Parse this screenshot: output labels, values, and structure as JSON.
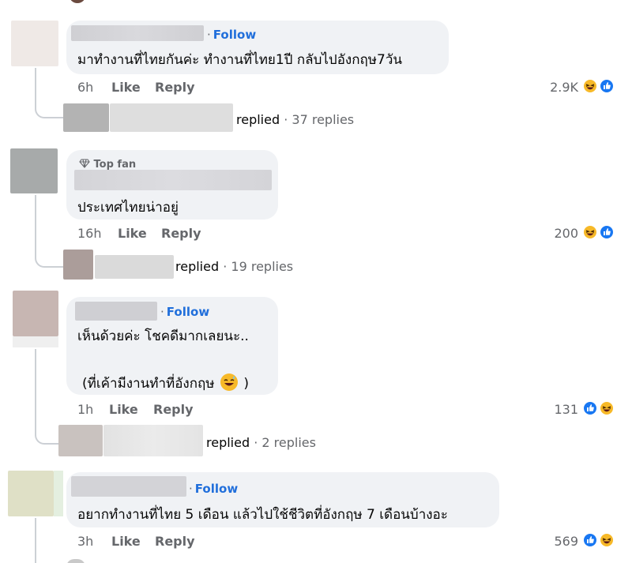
{
  "comments": [
    {
      "follow_label": "Follow",
      "text": "มาทำงานที่ไทยกันค่ะ ทำงานที่ไทย1ปี กลับไปอังกฤษ7วัน",
      "time": "6h",
      "like_label": "Like",
      "reply_label": "Reply",
      "reaction_count": "2.9K",
      "reactions": [
        "haha-icon",
        "like-icon"
      ],
      "replied_label": "replied",
      "reply_count": "· 37 replies"
    },
    {
      "badge": "Top fan",
      "text": "ประเทศไทยน่าอยู่",
      "time": "16h",
      "like_label": "Like",
      "reply_label": "Reply",
      "reaction_count": "200",
      "reactions": [
        "haha-icon",
        "like-icon"
      ],
      "replied_label": "replied",
      "reply_count": "· 19 replies"
    },
    {
      "follow_label": "Follow",
      "text_line1": "เห็นด้วยค่ะ โชคดีมากเลยนะ..",
      "text_line2": "(ที่เค้ามีงานทำที่อังกฤษ",
      "text_line2_end": ")",
      "time": "1h",
      "like_label": "Like",
      "reply_label": "Reply",
      "reaction_count": "131",
      "reactions": [
        "like-icon",
        "haha-icon"
      ],
      "replied_label": "replied",
      "reply_count": "· 2 replies"
    },
    {
      "follow_label": "Follow",
      "text": "อยากทำงานที่ไทย 5 เดือน แล้วไปใช้ชีวิตที่อังกฤษ 7 เดือนบ้างอะ",
      "time": "3h",
      "like_label": "Like",
      "reply_label": "Reply",
      "reaction_count": "569",
      "reactions": [
        "like-icon",
        "haha-icon"
      ]
    }
  ],
  "colors": {
    "follow": "#216fdb",
    "meta": "#65676b",
    "bubble": "#f0f2f5",
    "haha": "#f7b928",
    "like": "#1877f2"
  }
}
